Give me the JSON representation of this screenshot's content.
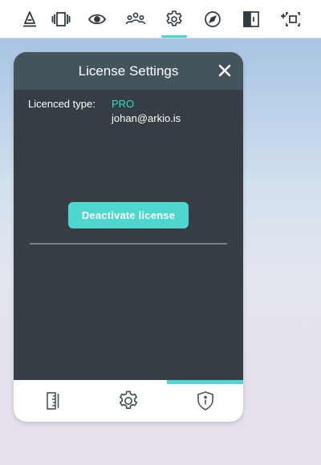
{
  "toolbar": {
    "items": [
      {
        "icon": "draw-icon"
      },
      {
        "icon": "layers-icon"
      },
      {
        "icon": "eye-icon"
      },
      {
        "icon": "people-icon"
      },
      {
        "icon": "gear-icon",
        "active": true
      },
      {
        "icon": "compass-icon"
      },
      {
        "icon": "section-icon"
      },
      {
        "icon": "add-view-icon"
      }
    ]
  },
  "panel": {
    "title": "License Settings",
    "licence_label": "Licenced type:",
    "licence_value": "PRO",
    "email": "johan@arkio.is",
    "deactivate_label": "Deactivate license"
  },
  "footer": {
    "tabs": [
      {
        "icon": "ruler-icon"
      },
      {
        "icon": "gear-icon"
      },
      {
        "icon": "shield-info-icon",
        "active": true
      }
    ]
  },
  "colors": {
    "accent": "#4fd6cf",
    "panel_bg": "#343e44",
    "panel_header": "#45535a",
    "pro_text": "#3fd8c8"
  }
}
